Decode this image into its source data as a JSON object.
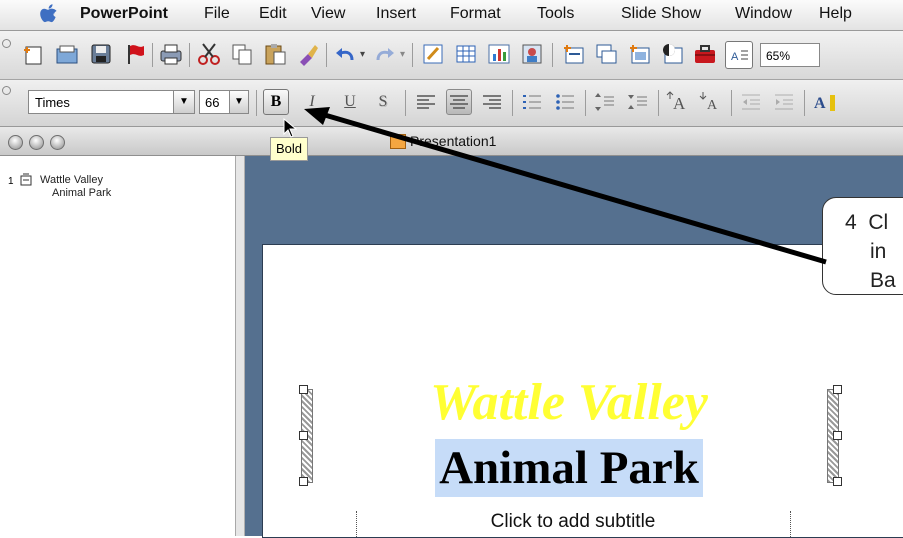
{
  "menubar": {
    "app_name": "PowerPoint",
    "items": [
      "File",
      "Edit",
      "View",
      "Insert",
      "Format",
      "Tools",
      "Slide Show",
      "Window",
      "Help"
    ]
  },
  "toolbar": {
    "zoom": "65%"
  },
  "formatting": {
    "font_name": "Times",
    "font_size": "66",
    "bold_label": "B",
    "italic_label": "I",
    "underline_label": "U",
    "shadow_label": "S",
    "tooltip": "Bold"
  },
  "window": {
    "title": "Presentation1"
  },
  "outline": {
    "slide_number": "1",
    "title_line1": "Wattle Valley",
    "title_line2": "Animal Park"
  },
  "slide": {
    "title_line1": "Wattle Valley",
    "title_line2": "Animal Park",
    "subtitle_placeholder": "Click to add subtitle"
  },
  "callout": {
    "line1": "4  Cl",
    "line2": "in",
    "line3": "Ba"
  },
  "colors": {
    "slide_background": "#55708f",
    "title_yellow": "#ffff33",
    "selection_highlight": "#c6dcf8"
  }
}
